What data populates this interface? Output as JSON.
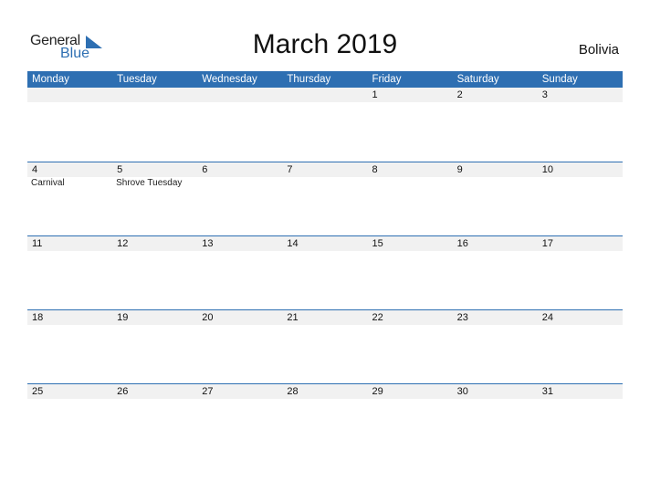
{
  "logo": {
    "part1": "General",
    "part2": "Blue"
  },
  "title": "March 2019",
  "country": "Bolivia",
  "colors": {
    "accent": "#2e6fb2",
    "date_row_bg": "#f1f1f1"
  },
  "weekdays": [
    "Monday",
    "Tuesday",
    "Wednesday",
    "Thursday",
    "Friday",
    "Saturday",
    "Sunday"
  ],
  "weeks": [
    {
      "days": [
        "",
        "",
        "",
        "",
        "1",
        "2",
        "3"
      ],
      "events": [
        "",
        "",
        "",
        "",
        "",
        "",
        ""
      ]
    },
    {
      "days": [
        "4",
        "5",
        "6",
        "7",
        "8",
        "9",
        "10"
      ],
      "events": [
        "Carnival",
        "Shrove Tuesday",
        "",
        "",
        "",
        "",
        ""
      ]
    },
    {
      "days": [
        "11",
        "12",
        "13",
        "14",
        "15",
        "16",
        "17"
      ],
      "events": [
        "",
        "",
        "",
        "",
        "",
        "",
        ""
      ]
    },
    {
      "days": [
        "18",
        "19",
        "20",
        "21",
        "22",
        "23",
        "24"
      ],
      "events": [
        "",
        "",
        "",
        "",
        "",
        "",
        ""
      ]
    },
    {
      "days": [
        "25",
        "26",
        "27",
        "28",
        "29",
        "30",
        "31"
      ],
      "events": [
        "",
        "",
        "",
        "",
        "",
        "",
        ""
      ]
    }
  ]
}
